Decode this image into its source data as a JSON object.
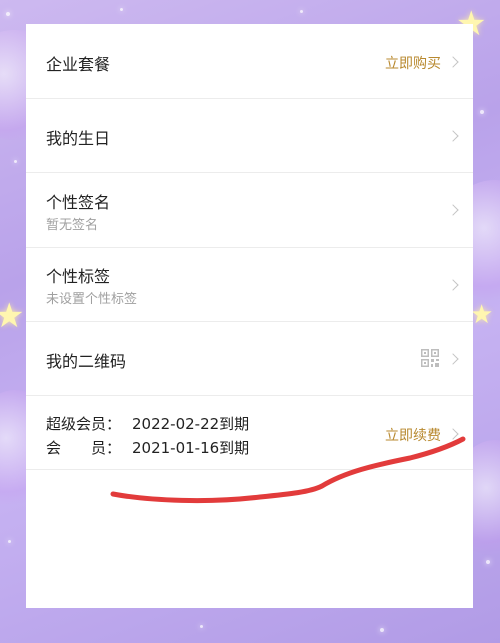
{
  "menu": {
    "enterprise": {
      "title": "企业套餐",
      "action": "立即购买"
    },
    "birthday": {
      "title": "我的生日"
    },
    "signature": {
      "title": "个性签名",
      "subtitle": "暂无签名"
    },
    "tags": {
      "title": "个性标签",
      "subtitle": "未设置个性标签"
    },
    "qrcode": {
      "title": "我的二维码",
      "icon": "qr-code-icon"
    },
    "membership": {
      "super_label": "超级会员：",
      "super_value": "2022-02-22到期",
      "member_label": "会　　员：",
      "member_value": "2021-01-16到期",
      "action": "立即续费"
    }
  },
  "colors": {
    "action_gold": "#b8892f",
    "annotation_red": "#e23b3b"
  }
}
